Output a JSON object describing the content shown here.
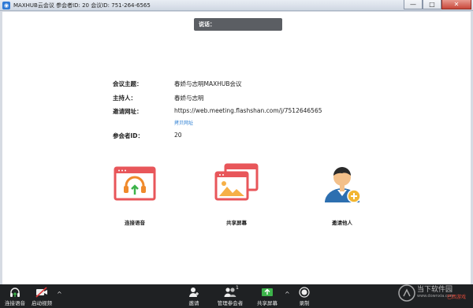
{
  "window": {
    "title": "MAXHUB云会议 参会者ID: 20   会议ID: 751-264-6565",
    "minimize": "—",
    "maximize": "□",
    "close": "✕"
  },
  "speaking": {
    "label": "说话：",
    "name": ""
  },
  "meeting": {
    "topic_label": "会议主题：",
    "topic": "春娇与志明MAXHUB会议",
    "host_label": "主持人：",
    "host": "春娇与志明",
    "invite_url_label": "邀请网址：",
    "invite_url": "https://web.meeting.flashshan.com/j/7512646565",
    "copy_url": "拷贝网址",
    "participant_id_label": "参会者ID：",
    "participant_id": "20"
  },
  "actions": {
    "connect_audio": "连接语音",
    "share_screen": "共享屏幕",
    "invite_others": "邀请他人"
  },
  "toolbar": {
    "connect_audio": "连接语音",
    "start_video": "启动视频",
    "invite": "邀请",
    "manage_participants": "管理参会者",
    "participant_count": "1",
    "share_screen": "共享屏幕",
    "record": "录制",
    "caret": "^"
  },
  "watermark": {
    "title": "当下软件园",
    "subtitle": "www.downxia.com",
    "tag": "巴西游戏"
  },
  "colors": {
    "accent_red": "#e8565a",
    "toolbar_bg": "#1f2123",
    "share_green": "#3cb34a",
    "link_blue": "#2d7fd3"
  }
}
